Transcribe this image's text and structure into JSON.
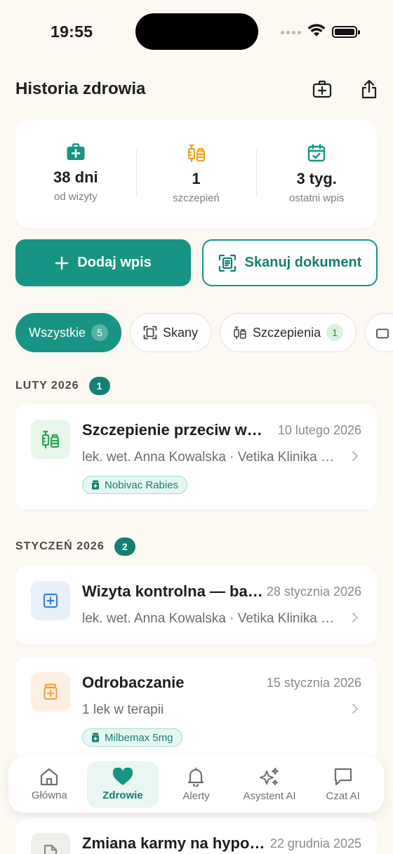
{
  "status_bar": {
    "time": "19:55"
  },
  "header": {
    "title": "Historia zdrowia"
  },
  "stats": [
    {
      "icon": "medical-kit-icon",
      "value": "38 dni",
      "label": "od wizyty"
    },
    {
      "icon": "vaccine-icon",
      "value": "1",
      "label": "szczepień"
    },
    {
      "icon": "calendar-check-icon",
      "value": "3 tyg.",
      "label": "ostatni wpis"
    }
  ],
  "actions": {
    "add_label": "Dodaj wpis",
    "scan_label": "Skanuj dokument"
  },
  "filters": [
    {
      "label": "Wszystkie",
      "count": "5",
      "active": true
    },
    {
      "label": "Skany",
      "count": null
    },
    {
      "label": "Szczepienia",
      "count": "1"
    }
  ],
  "sections": [
    {
      "title": "LUTY 2026",
      "count": "1",
      "entries": [
        {
          "icon": "vaccine-icon",
          "title": "Szczepienie przeciw wściekliźnie",
          "date": "10 lutego 2026",
          "subtitle": "lek. wet. Anna Kowalska · Vetika Klinika Weterynaryjna",
          "tag": "Nobivac Rabies"
        }
      ]
    },
    {
      "title": "STYCZEŃ 2026",
      "count": "2",
      "entries": [
        {
          "icon": "medical-plus-icon",
          "title": "Wizyta kontrolna — badanie ogólne",
          "date": "28 stycznia 2026",
          "subtitle": "lek. wet. Anna Kowalska · Vetika Klinika Weterynaryjna",
          "tag": null
        },
        {
          "icon": "medicine-bottle-icon",
          "title": "Odrobaczanie",
          "date": "15 stycznia 2026",
          "subtitle": "1 lek w terapii",
          "tag": "Milbemax 5mg"
        }
      ]
    },
    {
      "title": "",
      "count": "",
      "entries": [
        {
          "icon": "document-icon",
          "title": "Zmiana karmy na hypoalergiczną",
          "date": "22 grudnia 2025",
          "subtitle": "",
          "tag": null
        }
      ]
    }
  ],
  "tabs": [
    {
      "icon": "home-icon",
      "label": "Główna"
    },
    {
      "icon": "heart-icon",
      "label": "Zdrowie",
      "active": true
    },
    {
      "icon": "bell-icon",
      "label": "Alerty"
    },
    {
      "icon": "sparkles-icon",
      "label": "Asystent AI"
    },
    {
      "icon": "chat-icon",
      "label": "Czat AI"
    }
  ],
  "colors": {
    "accent": "#179484",
    "background": "#fcf9f3",
    "vaccine": "#f0a321",
    "plus_blue": "#3a7fd6",
    "bottle_orange": "#f0a14a"
  }
}
